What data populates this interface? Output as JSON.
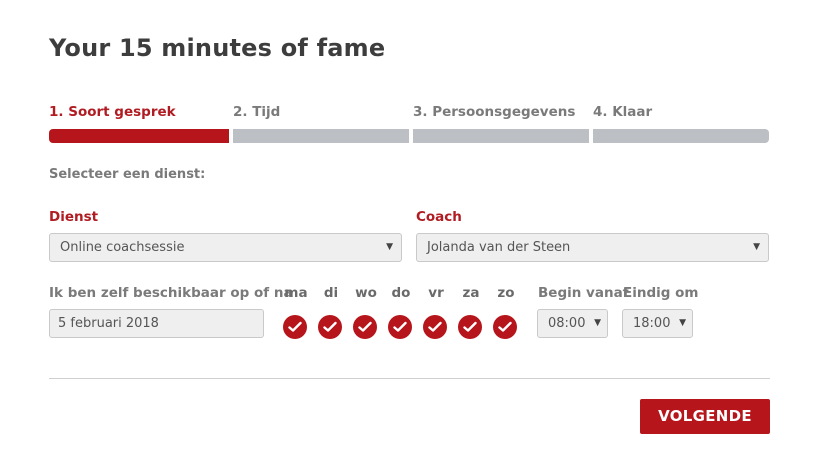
{
  "page": {
    "title": "Your 15 minutes of fame"
  },
  "steps": [
    {
      "label": "1. Soort gesprek",
      "active": true
    },
    {
      "label": "2. Tijd",
      "active": false
    },
    {
      "label": "3. Persoonsgegevens",
      "active": false
    },
    {
      "label": "4. Klaar",
      "active": false
    }
  ],
  "form": {
    "subheading": "Selecteer een dienst:",
    "dienst": {
      "label": "Dienst",
      "value": "Online coachsessie"
    },
    "coach": {
      "label": "Coach",
      "value": "Jolanda van der Steen"
    },
    "availability": {
      "label": "Ik ben zelf beschikbaar op of na",
      "date": "5 februari 2018"
    },
    "days": [
      {
        "label": "ma",
        "checked": true
      },
      {
        "label": "di",
        "checked": true
      },
      {
        "label": "wo",
        "checked": true
      },
      {
        "label": "do",
        "checked": true
      },
      {
        "label": "vr",
        "checked": true
      },
      {
        "label": "za",
        "checked": true
      },
      {
        "label": "zo",
        "checked": true
      }
    ],
    "begin": {
      "label": "Begin vanaf",
      "value": "08:00"
    },
    "end": {
      "label": "Eindig om",
      "value": "18:00"
    }
  },
  "actions": {
    "next_label": "VOLGENDE"
  },
  "colors": {
    "accent": "#b5151b",
    "inactive_step": "#bcbfc3"
  }
}
